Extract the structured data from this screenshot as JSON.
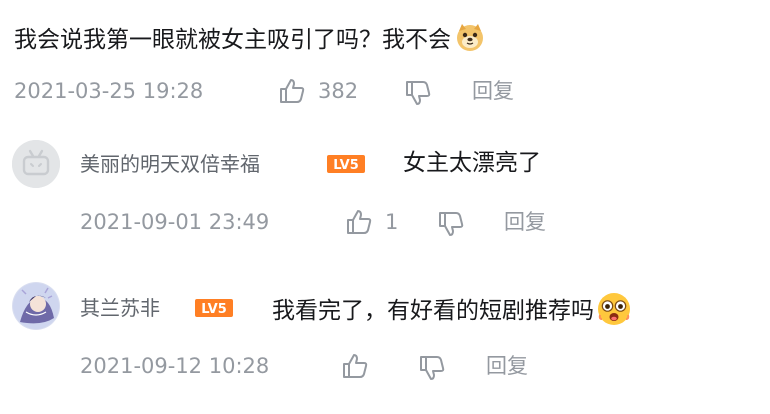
{
  "main_comment": {
    "text": "我会说我第一眼就被女主吸引了吗？我不会",
    "emoji": "doge-emoji",
    "date": "2021-03-25 19:28",
    "likes": "382",
    "reply_label": "回复"
  },
  "replies": [
    {
      "username": "美丽的明天双倍幸福",
      "level": "LV5",
      "text": "女主太漂亮了",
      "date": "2021-09-01 23:49",
      "likes": "1",
      "reply_label": "回复"
    },
    {
      "username": "其兰苏非",
      "level": "LV5",
      "text": "我看完了，有好看的短剧推荐吗",
      "emoji": "shocked-face-emoji",
      "date": "2021-09-12 10:28",
      "likes": "",
      "reply_label": "回复"
    }
  ],
  "colors": {
    "text": "#18191c",
    "meta": "#9499a0",
    "level_badge": "#ff7f24"
  }
}
